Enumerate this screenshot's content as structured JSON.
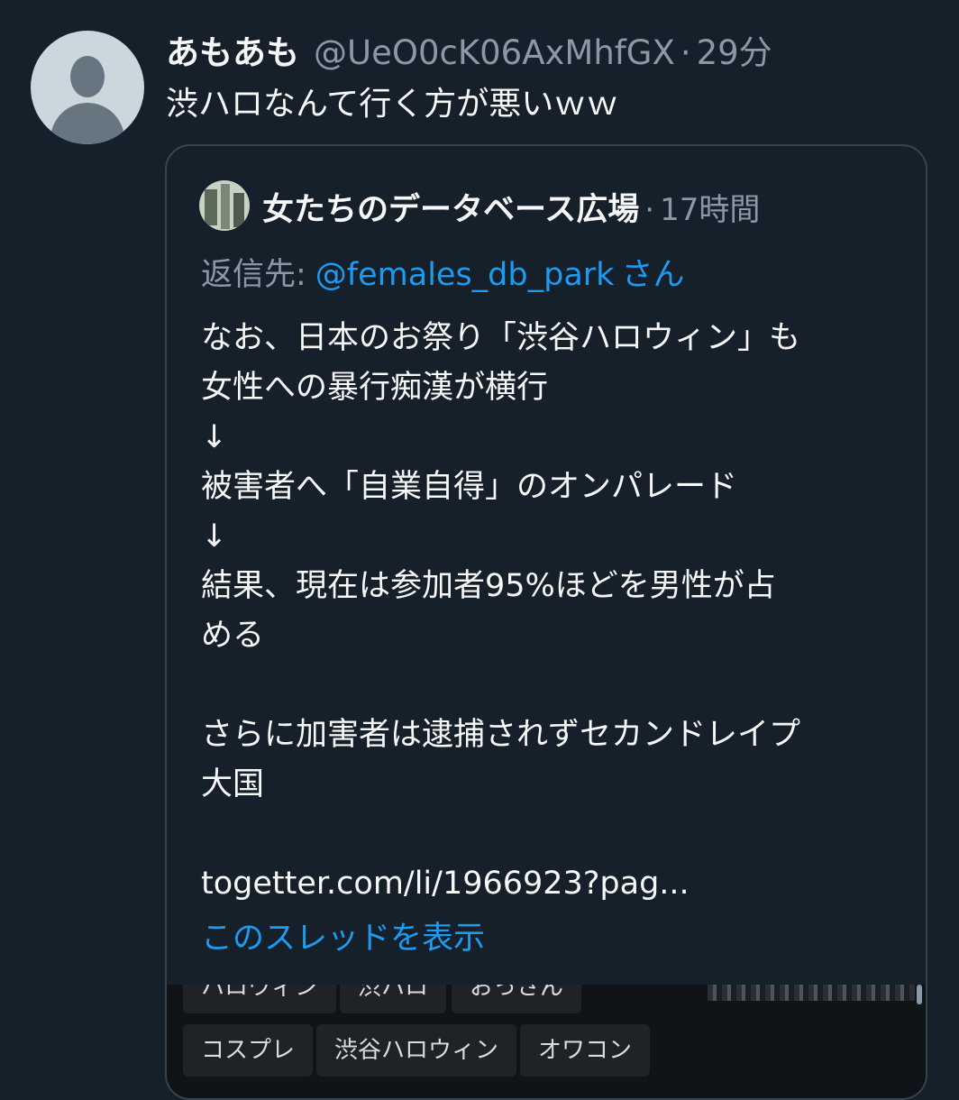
{
  "tweet": {
    "display_name": "あもあも",
    "handle": "@UeO0cK06AxMhfGX",
    "separator": "·",
    "time": "29分",
    "text": "渋ハロなんて行く方が悪いｗｗ"
  },
  "quote": {
    "display_name": "女たちのデータベース広場",
    "separator": "·",
    "time": "17時間",
    "reply_prefix": "返信先:",
    "reply_handle": "@females_db_park",
    "reply_suffix": "さん",
    "body_lines": [
      "なお、日本のお祭り「渋谷ハロウィン」も",
      "女性への暴行痴漢が横行",
      "↓",
      "被害者へ「自業自得」のオンパレード",
      "↓",
      "結果、現在は参加者95%ほどを男性が占",
      "める",
      "",
      "さらに加害者は逮捕されずセカンドレイプ",
      "大国",
      "",
      "togetter.com/li/1966923?pag..."
    ],
    "thread_link": "このスレッドを表示"
  },
  "media_tags": {
    "row1": [
      "ハロウィン",
      "渋ハロ",
      "おっさん"
    ],
    "row2": [
      "コスプレ",
      "渋谷ハロウィン",
      "オワコン"
    ]
  }
}
